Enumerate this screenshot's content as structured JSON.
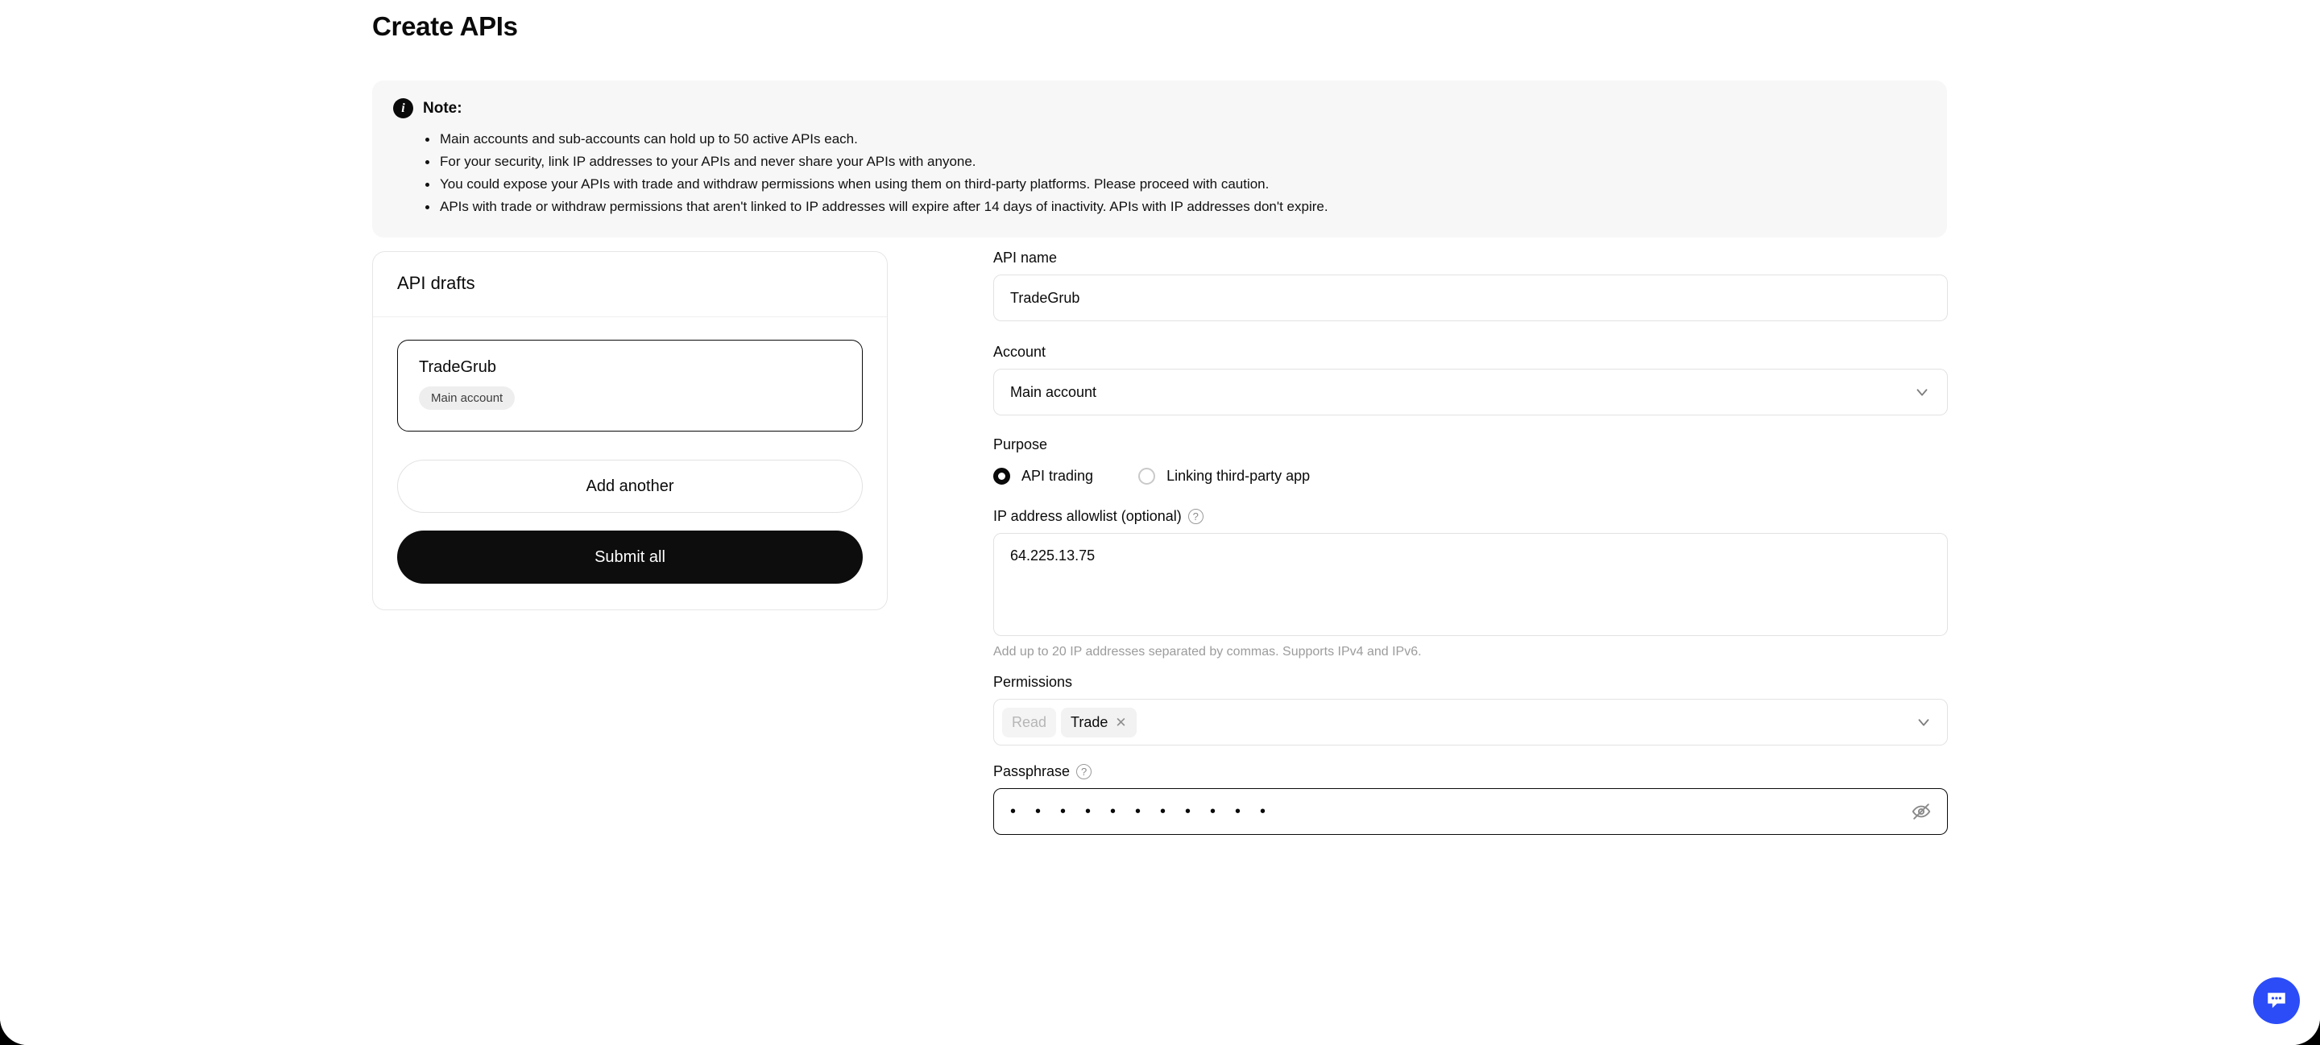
{
  "page": {
    "title": "Create APIs"
  },
  "note": {
    "icon": "info-icon",
    "title": "Note:",
    "items": [
      "Main accounts and sub-accounts can hold up to 50 active APIs each.",
      "For your security, link IP addresses to your APIs and never share your APIs with anyone.",
      "You could expose your APIs with trade and withdraw permissions when using them on third-party platforms. Please proceed with caution.",
      "APIs with trade or withdraw permissions that aren't linked to IP addresses will expire after 14 days of inactivity. APIs with IP addresses don't expire."
    ]
  },
  "drafts": {
    "title": "API drafts",
    "items": [
      {
        "name": "TradeGrub",
        "badge": "Main account"
      }
    ],
    "add_label": "Add another",
    "submit_label": "Submit all"
  },
  "form": {
    "api_name": {
      "label": "API name",
      "value": "TradeGrub",
      "placeholder": "Enter API name"
    },
    "account": {
      "label": "Account",
      "value": "Main account",
      "options": [
        "Main account"
      ],
      "icon": "chevron-down-icon"
    },
    "purpose": {
      "label": "Purpose",
      "options": [
        {
          "label": "API trading",
          "selected": true
        },
        {
          "label": "Linking third-party app",
          "selected": false
        }
      ]
    },
    "ip_allowlist": {
      "label": "IP address allowlist (optional)",
      "help_icon": "help-circle-icon",
      "value": "64.225.13.75",
      "placeholder": "Enter IP addresses",
      "hint": "Add up to 20 IP addresses separated by commas. Supports IPv4 and IPv6."
    },
    "permissions": {
      "label": "Permissions",
      "chips": [
        {
          "label": "Read",
          "removable": false,
          "locked": true
        },
        {
          "label": "Trade",
          "removable": true,
          "locked": false,
          "remove_icon": "close-icon"
        }
      ],
      "icon": "chevron-down-icon"
    },
    "passphrase": {
      "label": "Passphrase",
      "help_icon": "help-circle-icon",
      "value": "• • • • • • • • • • •",
      "masked_length": 11,
      "toggle_icon": "eye-off-icon",
      "focused": true
    }
  },
  "chat": {
    "icon": "chat-bubble-icon",
    "color": "#2b4cf7"
  },
  "colors": {
    "accent": "#2b4cf7",
    "text": "#0a0a0a",
    "muted": "#9c9c9c",
    "banner_bg": "#f7f7f7",
    "border": "#e2e2e2",
    "submit_bg": "#0d0d0d"
  }
}
